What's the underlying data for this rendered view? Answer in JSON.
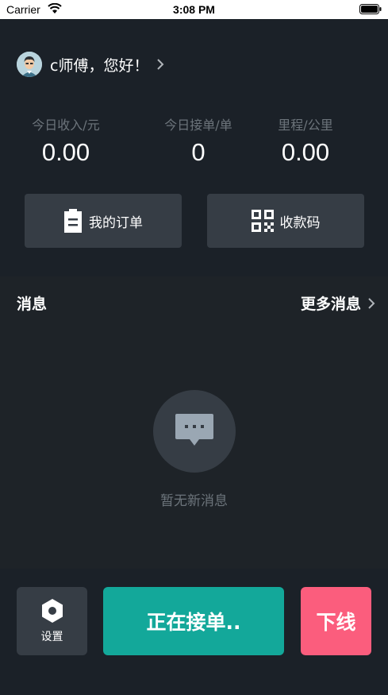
{
  "status_bar": {
    "carrier": "Carrier",
    "time": "3:08 PM"
  },
  "greeting": {
    "text": "c师傅，您好！"
  },
  "stats": [
    {
      "label": "今日收入/元",
      "value": "0.00"
    },
    {
      "label": "今日接单/单",
      "value": "0"
    },
    {
      "label": "里程/公里",
      "value": "0.00"
    }
  ],
  "actions": {
    "my_orders_label": "我的订单",
    "payment_code_label": "收款码"
  },
  "messages": {
    "title": "消息",
    "more_label": "更多消息",
    "empty_text": "暂无新消息"
  },
  "bottom_bar": {
    "settings_label": "设置",
    "accept_label": "正在接单..",
    "offline_label": "下线"
  },
  "colors": {
    "background": "#1e2328",
    "panel": "#1b2128",
    "button": "#363d45",
    "accept": "#13a89a",
    "offline": "#fb5d7d",
    "muted_text": "#6c747b"
  }
}
